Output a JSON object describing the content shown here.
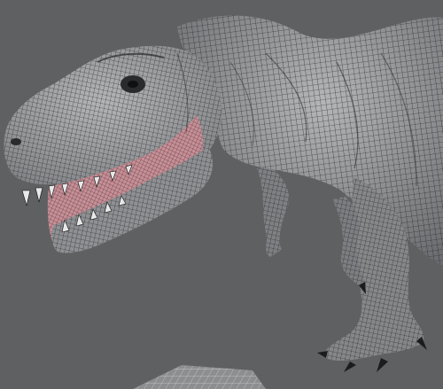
{
  "scene": {
    "subject": "dinosaur-wireframe-model",
    "colors": {
      "background": "#5f6061",
      "mesh_fill": "#a9abad",
      "mesh_fill_dark": "#6d6f71",
      "mesh_line": "#1a1b1c",
      "mouth_fill": "#c78f97",
      "tooth": "#e8e8e8",
      "ground_grid": "#d6d6d6"
    }
  }
}
